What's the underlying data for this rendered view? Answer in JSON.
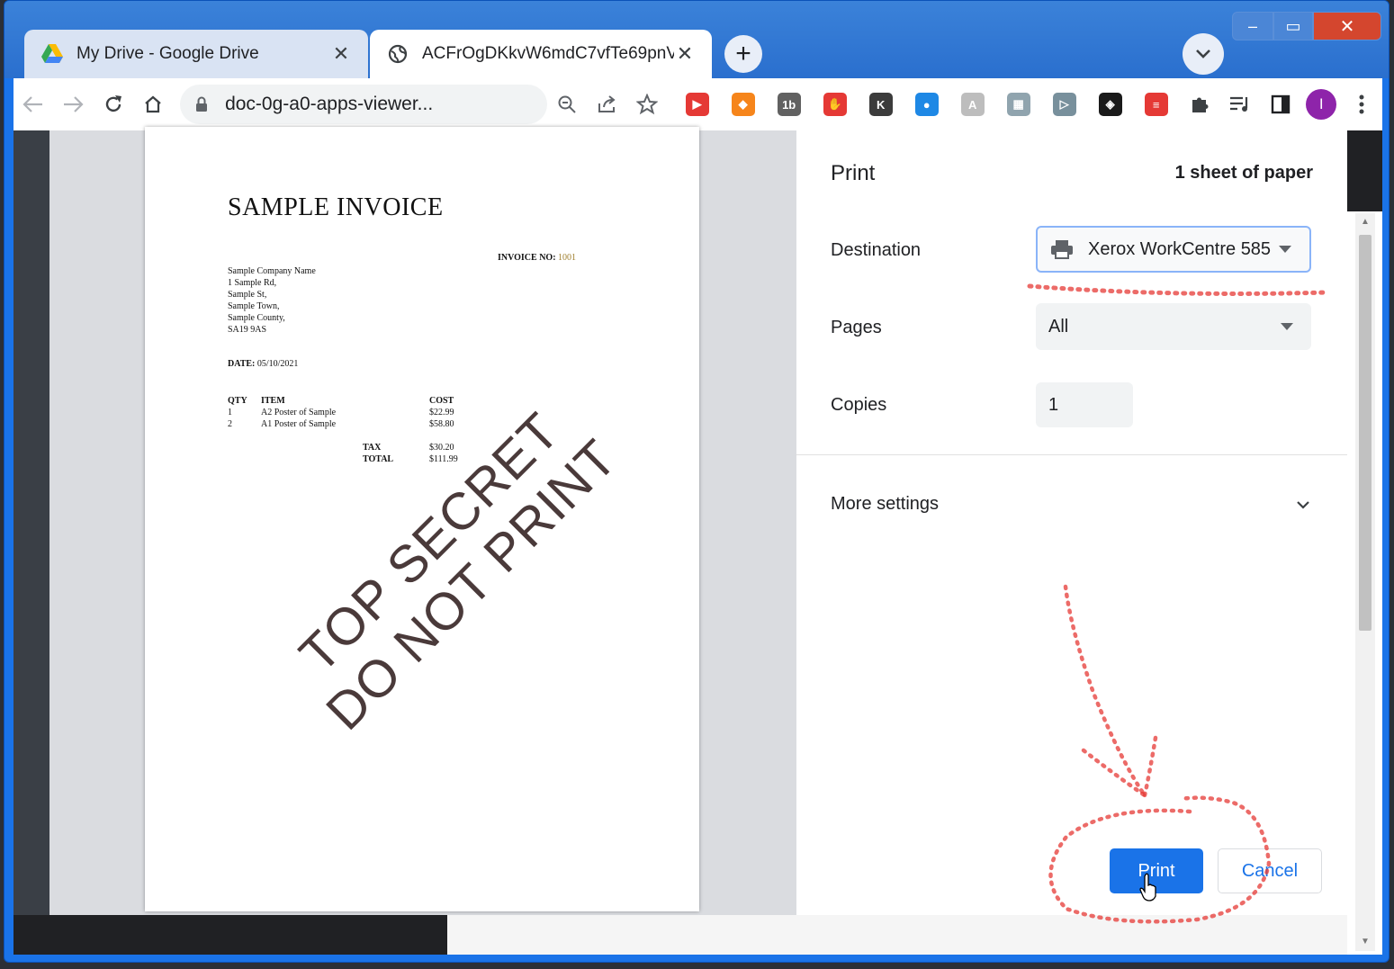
{
  "tabs": [
    {
      "title": "My Drive - Google Drive",
      "icon": "google-drive-icon",
      "active": false
    },
    {
      "title": "ACFrOgDKkvW6mdC7vfTe69pnV",
      "icon": "globe-icon",
      "active": true
    }
  ],
  "window_controls": {
    "minimize": "–",
    "maximize": "▭",
    "close": "✕"
  },
  "address_bar": {
    "url": "doc-0g-a0-apps-viewer..."
  },
  "profile": {
    "initial": "I",
    "color": "#8e24aa"
  },
  "extensions": [
    {
      "name": "fastforward-extension-icon",
      "color": "#e53935",
      "glyph": "▶"
    },
    {
      "name": "metamask-extension-icon",
      "color": "#f6851b",
      "glyph": "◆"
    },
    {
      "name": "1b-extension-icon",
      "color": "#616161",
      "glyph": "1b"
    },
    {
      "name": "adblock-extension-icon",
      "color": "#e53935",
      "glyph": "✋"
    },
    {
      "name": "k-extension-icon",
      "color": "#3c3c3c",
      "glyph": "K"
    },
    {
      "name": "blue-circle-extension-icon",
      "color": "#1e88e5",
      "glyph": "●"
    },
    {
      "name": "grey-tile-extension-icon",
      "color": "#bdbdbd",
      "glyph": "A"
    },
    {
      "name": "screenshot-extension-icon",
      "color": "#90a4ae",
      "glyph": "▦"
    },
    {
      "name": "video-extension-icon",
      "color": "#78909c",
      "glyph": "▷"
    },
    {
      "name": "binance-extension-icon",
      "color": "#1a1a1a",
      "glyph": "◈"
    },
    {
      "name": "red-stripes-extension-icon",
      "color": "#e53935",
      "glyph": "≡"
    }
  ],
  "invoice": {
    "title": "SAMPLE INVOICE",
    "invoice_no_label": "INVOICE NO:",
    "invoice_no": "1001",
    "address": [
      "Sample Company Name",
      "1 Sample Rd,",
      "Sample St,",
      "Sample Town,",
      "Sample County,",
      "SA19 9AS"
    ],
    "date_label": "DATE:",
    "date": "05/10/2021",
    "headers": {
      "qty": "QTY",
      "item": "ITEM",
      "cost": "COST"
    },
    "rows": [
      {
        "qty": "1",
        "item": "A2 Poster of Sample",
        "cost": "$22.99"
      },
      {
        "qty": "2",
        "item": "A1 Poster of Sample",
        "cost": "$58.80"
      }
    ],
    "tax_label": "TAX",
    "tax": "$30.20",
    "total_label": "TOTAL",
    "total": "$111.99",
    "watermark_line1": "TOP SECRET",
    "watermark_line2": "DO NOT PRINT"
  },
  "print_panel": {
    "title": "Print",
    "sheets": "1 sheet of paper",
    "destination_label": "Destination",
    "destination_value": "Xerox WorkCentre 585",
    "pages_label": "Pages",
    "pages_value": "All",
    "copies_label": "Copies",
    "copies_value": "1",
    "more_settings": "More settings",
    "print_button": "Print",
    "cancel_button": "Cancel"
  },
  "annotation_color": "#e53935"
}
